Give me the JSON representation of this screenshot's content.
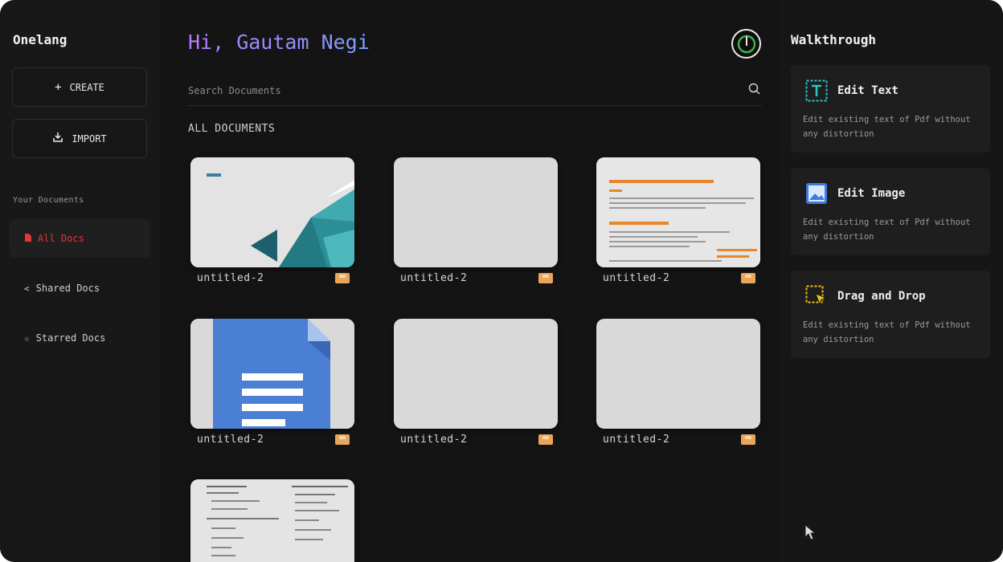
{
  "brand": "Onelang",
  "sidebar": {
    "create_label": "CREATE",
    "import_label": "IMPORT",
    "section_label": "Your Documents",
    "nav": [
      {
        "label": "All Docs",
        "icon": "file-icon",
        "active": true
      },
      {
        "label": "Shared Docs",
        "icon": "share-icon",
        "active": false
      },
      {
        "label": "Starred Docs",
        "icon": "star-icon",
        "active": false
      }
    ]
  },
  "main": {
    "greeting": "Hi, Gautam Negi",
    "search_placeholder": "Search Documents",
    "section_title": "ALL DOCUMENTS",
    "documents": [
      {
        "name": "untitled-2",
        "thumb": "presentation"
      },
      {
        "name": "untitled-2",
        "thumb": "blank"
      },
      {
        "name": "untitled-2",
        "thumb": "orange-text-doc"
      },
      {
        "name": "untitled-2",
        "thumb": "google-docs"
      },
      {
        "name": "untitled-2",
        "thumb": "blank"
      },
      {
        "name": "untitled-2",
        "thumb": "blank"
      },
      {
        "name": "",
        "thumb": "form-doc"
      }
    ]
  },
  "walkthrough": {
    "title": "Walkthrough",
    "cards": [
      {
        "title": "Edit Text",
        "icon": "text-edit-icon",
        "description": "Edit existing text of Pdf without any distortion"
      },
      {
        "title": "Edit Image",
        "icon": "image-edit-icon",
        "description": "Edit existing text of Pdf without any distortion"
      },
      {
        "title": "Drag and Drop",
        "icon": "drag-drop-icon",
        "description": "Edit existing text of Pdf without any distortion"
      }
    ]
  },
  "colors": {
    "accent_red": "#e8323c",
    "greeting_gradient_start": "#b57bff",
    "greeting_gradient_end": "#7aa2ff",
    "badge": "#e9a55a"
  }
}
